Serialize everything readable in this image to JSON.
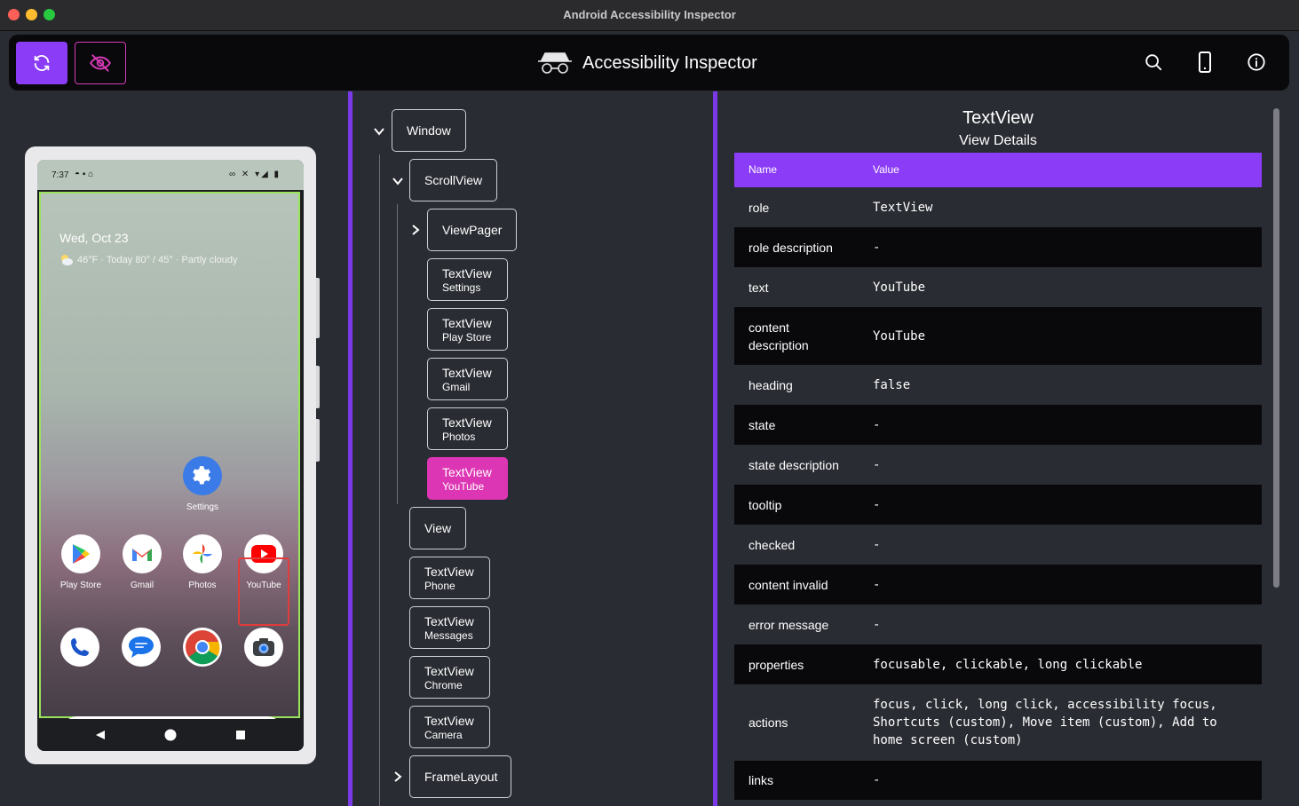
{
  "window": {
    "title": "Android Accessibility Inspector"
  },
  "app": {
    "title": "Accessibility Inspector"
  },
  "toolbar": {
    "refresh_icon": "refresh-icon",
    "hide_icon": "eye-off-icon",
    "search_icon": "search-icon",
    "device_icon": "phone-icon",
    "info_icon": "info-icon",
    "accent": "#8b3cf7",
    "highlight": "#dd36b4"
  },
  "phone": {
    "status_time": "7:37",
    "date": "Wed, Oct 23",
    "weather": "46°F  · Today 80° / 45° · Partly cloudy",
    "apps": {
      "settings": "Settings",
      "play_store": "Play Store",
      "gmail": "Gmail",
      "photos": "Photos",
      "youtube": "YouTube"
    }
  },
  "tree": {
    "window": "Window",
    "scrollview": "ScrollView",
    "viewpager": "ViewPager",
    "tv_settings": {
      "type": "TextView",
      "text": "Settings"
    },
    "tv_playstore": {
      "type": "TextView",
      "text": "Play Store"
    },
    "tv_gmail": {
      "type": "TextView",
      "text": "Gmail"
    },
    "tv_photos": {
      "type": "TextView",
      "text": "Photos"
    },
    "tv_youtube": {
      "type": "TextView",
      "text": "YouTube"
    },
    "view": "View",
    "tv_phone": {
      "type": "TextView",
      "text": "Phone"
    },
    "tv_messages": {
      "type": "TextView",
      "text": "Messages"
    },
    "tv_chrome": {
      "type": "TextView",
      "text": "Chrome"
    },
    "tv_camera": {
      "type": "TextView",
      "text": "Camera"
    },
    "framelayout": "FrameLayout"
  },
  "details": {
    "title": "TextView",
    "subtitle": "View Details",
    "col_name": "Name",
    "col_value": "Value",
    "rows": [
      {
        "name": "role",
        "value": "TextView"
      },
      {
        "name": "role description",
        "value": "-"
      },
      {
        "name": "text",
        "value": "YouTube"
      },
      {
        "name": "content description",
        "value": "YouTube"
      },
      {
        "name": "heading",
        "value": "false"
      },
      {
        "name": "state",
        "value": "-"
      },
      {
        "name": "state description",
        "value": "-"
      },
      {
        "name": "tooltip",
        "value": "-"
      },
      {
        "name": "checked",
        "value": "-"
      },
      {
        "name": "content invalid",
        "value": "-"
      },
      {
        "name": "error message",
        "value": "-"
      },
      {
        "name": "properties",
        "value": "focusable, clickable, long clickable"
      },
      {
        "name": "actions",
        "value": "focus, click, long click, accessibility focus, Shortcuts (custom), Move item (custom), Add to home screen (custom)"
      },
      {
        "name": "links",
        "value": "-"
      }
    ]
  }
}
